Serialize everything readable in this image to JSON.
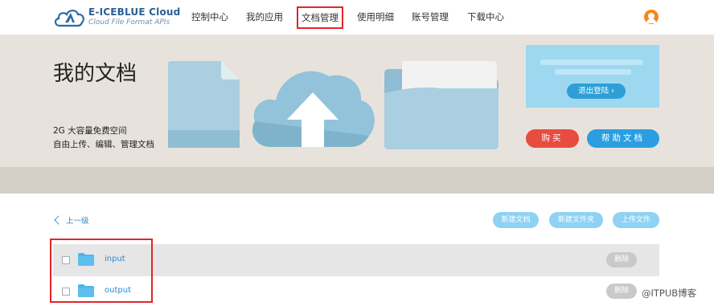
{
  "brand": {
    "title": "E-ICEBLUE Cloud",
    "subtitle": "Cloud File Format APIs",
    "accent": "#2b5f94"
  },
  "nav": {
    "items": [
      {
        "label": "控制中心"
      },
      {
        "label": "我的应用"
      },
      {
        "label": "文档管理",
        "active": true
      },
      {
        "label": "使用明细"
      },
      {
        "label": "账号管理"
      },
      {
        "label": "下载中心"
      }
    ],
    "avatar_icon": "user-avatar-icon",
    "active_outline_color": "#e2252b"
  },
  "banner": {
    "title": "我的文档",
    "line1": "2G 大容量免费空间",
    "line2": "自由上传、编辑、管理文档"
  },
  "account": {
    "logout_label": "退出登陆 ›",
    "buy_label": "购买",
    "help_label": "帮助文档",
    "buy_color": "#e84b3f",
    "help_color": "#2a9ee0"
  },
  "toolbar": {
    "back_label": "上一级",
    "new_doc_label": "新建文档",
    "new_folder_label": "新建文件夹",
    "upload_label": "上传文件"
  },
  "files": [
    {
      "name": "input",
      "delete_label": "删除",
      "checked": false
    },
    {
      "name": "output",
      "delete_label": "删除",
      "checked": false
    }
  ],
  "watermark": "@ITPUB博客"
}
